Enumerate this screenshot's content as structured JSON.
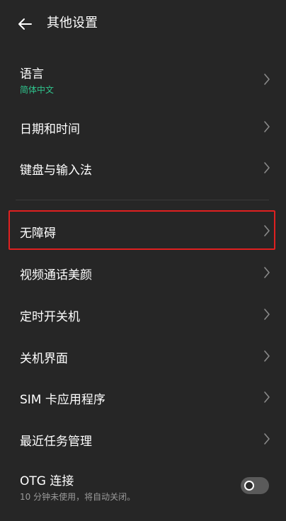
{
  "header": {
    "title": "其他设置",
    "back_icon": "arrow-left-icon"
  },
  "items": [
    {
      "label": "语言",
      "sub": "简体中文"
    },
    {
      "label": "日期和时间"
    },
    {
      "label": "键盘与输入法"
    },
    {
      "label": "无障碍"
    },
    {
      "label": "视频通话美颜"
    },
    {
      "label": "定时开关机"
    },
    {
      "label": "关机界面"
    },
    {
      "label": "SIM 卡应用程序"
    },
    {
      "label": "最近任务管理"
    },
    {
      "label": "OTG 连接",
      "sub": "10 分钟未使用，将自动关闭。",
      "toggle_on": false
    }
  ],
  "colors": {
    "background": "#262626",
    "text": "#ffffff",
    "accent_sub": "#2fc48d",
    "sub_gray": "#9a9a9a",
    "highlight": "#e02020",
    "chevron": "#8a8a8a"
  },
  "icons": {
    "chevron": "chevron-right-icon"
  }
}
